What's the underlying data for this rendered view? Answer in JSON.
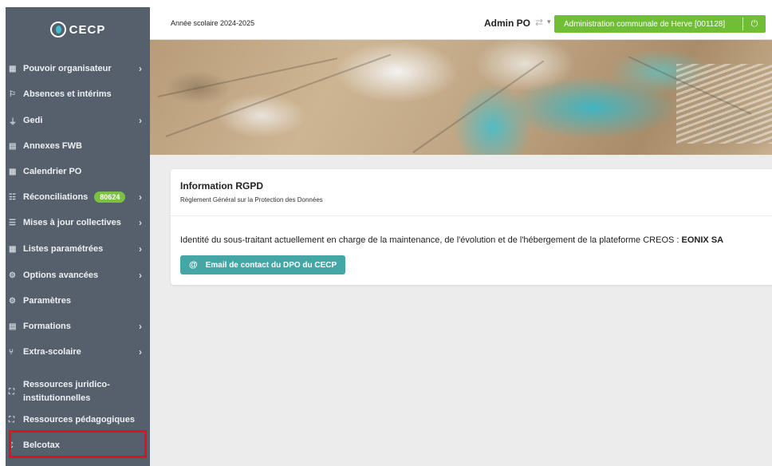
{
  "app": {
    "logo_text": "CECP"
  },
  "sidebar": {
    "items": [
      {
        "label": "Pouvoir organisateur",
        "icon": "building-icon",
        "glyph": "▦",
        "chevron": true
      },
      {
        "label": "Absences et intérims",
        "icon": "flag-icon",
        "glyph": "⚐",
        "chevron": false
      },
      {
        "label": "Gedi",
        "icon": "plug-icon",
        "glyph": "⏚",
        "chevron": true
      },
      {
        "label": "Annexes FWB",
        "icon": "document-icon",
        "glyph": "▤",
        "chevron": false
      },
      {
        "label": "Calendrier PO",
        "icon": "calendar-icon",
        "glyph": "▦",
        "chevron": false
      },
      {
        "label": "Réconciliations",
        "icon": "users-icon",
        "glyph": "☷",
        "chevron": true,
        "badge": "80624"
      },
      {
        "label": "Mises à jour collectives",
        "icon": "list-icon",
        "glyph": "☰",
        "chevron": true
      },
      {
        "label": "Listes paramétrées",
        "icon": "table-icon",
        "glyph": "▦",
        "chevron": true
      },
      {
        "label": "Options avancées",
        "icon": "gears-icon",
        "glyph": "⚙",
        "chevron": true
      },
      {
        "label": "Paramètres",
        "icon": "gear-icon",
        "glyph": "⚙",
        "chevron": false
      },
      {
        "label": "Formations",
        "icon": "book-icon",
        "glyph": "▤",
        "chevron": true
      },
      {
        "label": "Extra-scolaire",
        "icon": "utensils-icon",
        "glyph": "⑂",
        "chevron": true
      },
      {
        "label": "Ressources juridico-institutionnelles",
        "icon": "presentation-icon",
        "glyph": "⛶",
        "chevron": false
      },
      {
        "label": "Ressources pédagogiques",
        "icon": "presentation-icon",
        "glyph": "⛶",
        "chevron": false
      },
      {
        "label": "Belcotax",
        "icon": "euro-icon",
        "glyph": "€",
        "chevron": false
      }
    ]
  },
  "topbar": {
    "school_year": "Année scolaire 2024-2025",
    "user_role": "Admin PO",
    "org_button": "Administration communale de Herve [001128]"
  },
  "info_card": {
    "title": "Information RGPD",
    "subtitle": "Règlement Général sur la Protection des Données",
    "text": "Identité du sous-traitant actuellement en charge de la maintenance, de l'évolution et de l'hébergement de la plateforme CREOS : ",
    "company": "EONIX SA",
    "button_label": "Email de contact du DPO du CECP"
  },
  "colors": {
    "sidebar_bg": "#56606c",
    "accent_green": "#6fbe35",
    "badge_green": "#7dc142",
    "button_teal": "#43a7a6",
    "highlight_red": "#e0121a"
  }
}
